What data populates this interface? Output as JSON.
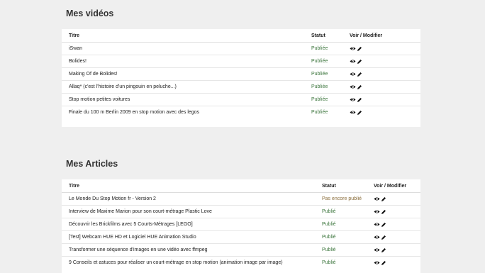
{
  "videos": {
    "heading": "Mes vidéos",
    "columns": {
      "title": "Titre",
      "status": "Statut",
      "actions": "Voir / Modifier"
    },
    "rows": [
      {
        "title": "iSwan",
        "status": "Publiée"
      },
      {
        "title": "Bolides!",
        "status": "Publiée"
      },
      {
        "title": "Making Of de Bolides!",
        "status": "Publiée"
      },
      {
        "title": "Allaq* (c'est l'histoire d'un pingouin en peluche...)",
        "status": "Publiée"
      },
      {
        "title": "Stop motion petites voitures",
        "status": "Publiée"
      },
      {
        "title": "Finale du 100 m Berlin 2009 en stop motion avec des legos",
        "status": "Publiée"
      }
    ]
  },
  "articles": {
    "heading": "Mes Articles",
    "columns": {
      "title": "Titre",
      "status": "Statut",
      "actions": "Voir / Modifier"
    },
    "rows": [
      {
        "title": "Le Monde Du Stop Motion fr - Version 2",
        "status": "Pas encore publié",
        "pending": true
      },
      {
        "title": "Interview de Maxime Marion pour son court-métrage Plastic Love",
        "status": "Publié"
      },
      {
        "title": "Découvrir les Brickfilms avec 5 Courts-Métrages [LEGO]",
        "status": "Publié"
      },
      {
        "title": "[Test] Webcam HUE HD et Logiciel HUE Animation Studio",
        "status": "Publié"
      },
      {
        "title": "Transformer une séquence d'images en une vidéo avec ffmpeg",
        "status": "Publié"
      },
      {
        "title": "9 Conseils et astuces pour réaliser un court-métrage en stop motion (animation image par image)",
        "status": "Publié"
      }
    ]
  },
  "icons": {
    "view": "eye-icon",
    "edit": "pencil-icon"
  },
  "colors": {
    "published": "#3c763d",
    "pending": "#8a6d3b",
    "background": "#efefef"
  }
}
